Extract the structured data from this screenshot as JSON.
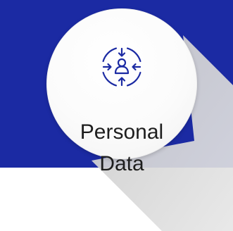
{
  "card": {
    "title_line1": "Personal",
    "title_line2": "Data",
    "icon": "person-target-icon"
  },
  "colors": {
    "band": "#1b2aa3",
    "icon_stroke": "#1b2aa3",
    "circle": "#fbfbfb",
    "shadow": "#d9d9d9",
    "text": "#1e1e1e"
  }
}
